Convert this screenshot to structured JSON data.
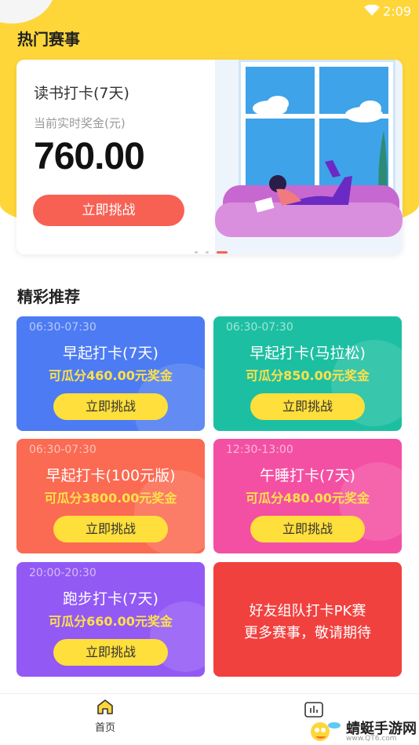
{
  "status_bar": {
    "time": "2:09"
  },
  "hot_section": {
    "title": "热门赛事",
    "card": {
      "name": "读书打卡(7天)",
      "prize_label": "当前实时奖金(元)",
      "amount": "760.00",
      "button": "立即挑战"
    }
  },
  "rec_section": {
    "title": "精彩推荐",
    "cards": [
      {
        "time": "06:30-07:30",
        "title": "早起打卡(7天)",
        "prize": "可瓜分460.00元奖金",
        "button": "立即挑战",
        "color": "#4d7bf3"
      },
      {
        "time": "06:30-07:30",
        "title": "早起打卡(马拉松)",
        "prize": "可瓜分850.00元奖金",
        "button": "立即挑战",
        "color": "#1dbfa2"
      },
      {
        "time": "06:30-07:30",
        "title": "早起打卡(100元版)",
        "prize": "可瓜分3800.00元奖金",
        "button": "立即挑战",
        "color": "#fb6a52"
      },
      {
        "time": "12:30-13:00",
        "title": "午睡打卡(7天)",
        "prize": "可瓜分480.00元奖金",
        "button": "立即挑战",
        "color": "#f450a3"
      },
      {
        "time": "20:00-20:30",
        "title": "跑步打卡(7天)",
        "prize": "可瓜分660.00元奖金",
        "button": "立即挑战",
        "color": "#9259f5"
      },
      {
        "line1": "好友组队打卡PK赛",
        "line2": "更多赛事，敬请期待",
        "color": "#f1413f"
      }
    ]
  },
  "tabbar": {
    "home": "首页"
  },
  "watermark": {
    "title": "蜻蜓手游网",
    "url": "www.QT6.com"
  }
}
